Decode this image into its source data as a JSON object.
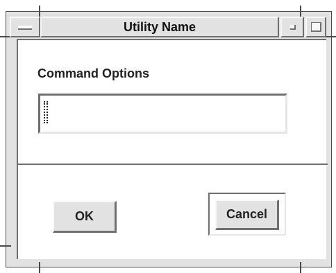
{
  "window": {
    "title": "Utility Name",
    "window_menu_icon": "window-menu-icon",
    "minimize_icon": "minimize-icon",
    "maximize_icon": "maximize-icon"
  },
  "dialog": {
    "command_options_label": "Command Options",
    "command_options_value": "",
    "ok_label": "OK",
    "cancel_label": "Cancel",
    "default_button": "Cancel"
  },
  "colors": {
    "frame": "#e2e2e2",
    "client": "#ffffff",
    "shadow": "#6f6f6f",
    "highlight": "#f8f8f8"
  }
}
